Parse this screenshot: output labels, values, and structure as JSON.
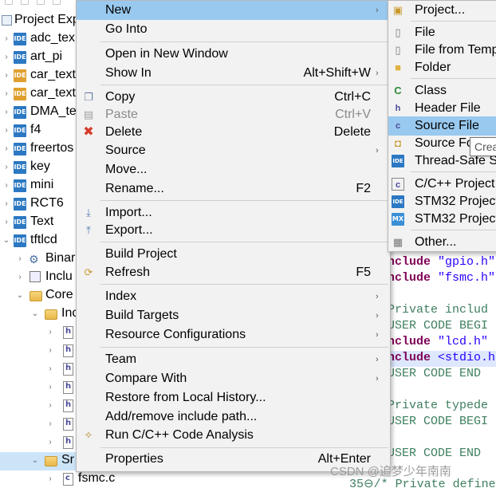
{
  "explorer": {
    "title": "Project Exp",
    "items": [
      {
        "label": "adc_tex",
        "icon": "ide-project-icon"
      },
      {
        "label": "art_pi",
        "icon": "ide-project-icon"
      },
      {
        "label": "car_text",
        "icon": "ide-project-icon"
      },
      {
        "label": "car_text",
        "icon": "ide-project-icon"
      },
      {
        "label": "DMA_te",
        "icon": "ide-project-icon"
      },
      {
        "label": "f4",
        "icon": "ide-project-icon"
      },
      {
        "label": "freertos",
        "icon": "ide-project-icon"
      },
      {
        "label": "key",
        "icon": "ide-project-icon"
      },
      {
        "label": "mini",
        "icon": "ide-project-icon"
      },
      {
        "label": "RCT6",
        "icon": "ide-project-icon"
      },
      {
        "label": "Text",
        "icon": "ide-project-icon"
      },
      {
        "label": "tftlcd",
        "icon": "ide-project-icon"
      },
      {
        "label": "Binar",
        "icon": "binaries-icon"
      },
      {
        "label": "Inclu",
        "icon": "includes-icon"
      },
      {
        "label": "Core",
        "icon": "folder-icon"
      },
      {
        "label": "Inc",
        "icon": "folder-icon"
      },
      {
        "label": "",
        "icon": "header-file-icon"
      },
      {
        "label": "",
        "icon": "header-file-icon"
      },
      {
        "label": "",
        "icon": "header-file-icon"
      },
      {
        "label": "",
        "icon": "header-file-icon"
      },
      {
        "label": "",
        "icon": "header-file-icon"
      },
      {
        "label": "",
        "icon": "header-file-icon"
      },
      {
        "label": "",
        "icon": "header-file-icon"
      },
      {
        "label": "",
        "icon": "header-file-icon"
      },
      {
        "label": "Sr",
        "icon": "folder-icon"
      },
      {
        "label": "fsmc.c",
        "icon": "c-file-icon"
      }
    ]
  },
  "context_menu": {
    "items": [
      {
        "label": "New",
        "shortcut": "",
        "submenu": true,
        "icon": ""
      },
      {
        "label": "Go Into",
        "shortcut": "",
        "submenu": false,
        "icon": ""
      },
      {
        "label": "Open in New Window",
        "shortcut": "",
        "submenu": false,
        "icon": ""
      },
      {
        "label": "Show In",
        "shortcut": "Alt+Shift+W",
        "submenu": true,
        "icon": ""
      },
      {
        "label": "Copy",
        "shortcut": "Ctrl+C",
        "submenu": false,
        "icon": "copy-icon"
      },
      {
        "label": "Paste",
        "shortcut": "Ctrl+V",
        "submenu": false,
        "icon": "paste-icon"
      },
      {
        "label": "Delete",
        "shortcut": "Delete",
        "submenu": false,
        "icon": "delete-icon"
      },
      {
        "label": "Source",
        "shortcut": "",
        "submenu": true,
        "icon": ""
      },
      {
        "label": "Move...",
        "shortcut": "",
        "submenu": false,
        "icon": ""
      },
      {
        "label": "Rename...",
        "shortcut": "F2",
        "submenu": false,
        "icon": ""
      },
      {
        "label": "Import...",
        "shortcut": "",
        "submenu": false,
        "icon": "import-icon"
      },
      {
        "label": "Export...",
        "shortcut": "",
        "submenu": false,
        "icon": "export-icon"
      },
      {
        "label": "Build Project",
        "shortcut": "",
        "submenu": false,
        "icon": ""
      },
      {
        "label": "Refresh",
        "shortcut": "F5",
        "submenu": false,
        "icon": "refresh-icon"
      },
      {
        "label": "Index",
        "shortcut": "",
        "submenu": true,
        "icon": ""
      },
      {
        "label": "Build Targets",
        "shortcut": "",
        "submenu": true,
        "icon": ""
      },
      {
        "label": "Resource Configurations",
        "shortcut": "",
        "submenu": true,
        "icon": ""
      },
      {
        "label": "Team",
        "shortcut": "",
        "submenu": true,
        "icon": ""
      },
      {
        "label": "Compare With",
        "shortcut": "",
        "submenu": true,
        "icon": ""
      },
      {
        "label": "Restore from Local History...",
        "shortcut": "",
        "submenu": false,
        "icon": ""
      },
      {
        "label": "Add/remove include path...",
        "shortcut": "",
        "submenu": false,
        "icon": ""
      },
      {
        "label": "Run C/C++ Code Analysis",
        "shortcut": "",
        "submenu": false,
        "icon": "code-analysis-icon"
      },
      {
        "label": "Properties",
        "shortcut": "Alt+Enter",
        "submenu": false,
        "icon": ""
      }
    ]
  },
  "new_submenu": {
    "items": [
      {
        "label": "Project...",
        "icon": "new-project-icon"
      },
      {
        "label": "File",
        "icon": "file-icon"
      },
      {
        "label": "File from Temp",
        "icon": "file-template-icon"
      },
      {
        "label": "Folder",
        "icon": "folder-icon"
      },
      {
        "label": "Class",
        "icon": "class-icon"
      },
      {
        "label": "Header File",
        "icon": "header-file-icon"
      },
      {
        "label": "Source File",
        "icon": "source-file-icon"
      },
      {
        "label": "Source Fo",
        "icon": "source-folder-icon"
      },
      {
        "label": "Thread-Safe Sc",
        "icon": "ide-icon"
      },
      {
        "label": "C/C++ Project",
        "icon": "cpp-project-icon"
      },
      {
        "label": "STM32 Project",
        "icon": "ide-icon"
      },
      {
        "label": "STM32 Project",
        "icon": "mx-icon"
      },
      {
        "label": "Other...",
        "icon": "other-icon"
      }
    ],
    "tooltip": "Crea"
  },
  "editor": {
    "lines": [
      {
        "kw": "nclude",
        "rest": " \"gpio.h\""
      },
      {
        "kw": "nclude",
        "rest": " \"fsmc.h\""
      },
      {
        "comment": " Private includ"
      },
      {
        "comment": " USER CODE BEGI"
      },
      {
        "kw": "nclude",
        "rest": " \"lcd.h\""
      },
      {
        "kw": "nclude",
        "rest": " <stdio.h"
      },
      {
        "comment": " USER CODE END"
      },
      {
        "comment": " Private typede"
      },
      {
        "comment": " USER CODE BEGI"
      },
      {
        "comment": " USER CODE END"
      },
      {
        "comment": "35⊖/* Private define"
      }
    ]
  },
  "watermark": "CSDN @追梦少年南南",
  "colors": {
    "menu_bg": "#f2f2f2",
    "menu_highlight": "#99c9ef",
    "ide_blue": "#2c78c2",
    "keyword": "#7f0055",
    "string": "#2a00ff",
    "comment": "#3f7f5f"
  }
}
